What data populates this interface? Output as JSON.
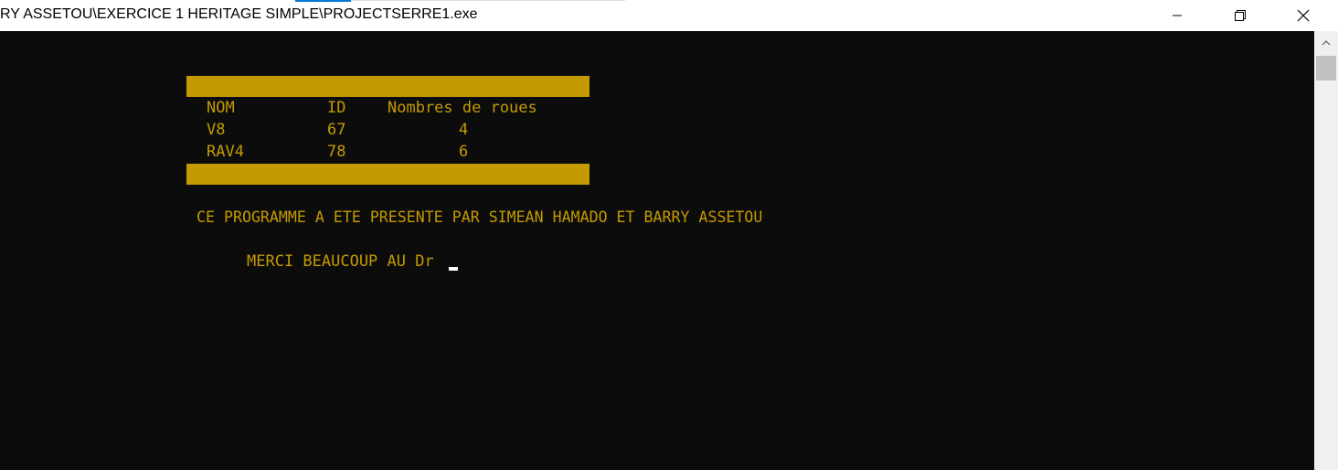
{
  "window": {
    "title": "RY ASSETOU\\EXERCICE 1 HERITAGE SIMPLE\\PROJECTSERRE1.exe",
    "controls": {
      "minimize_icon": "minimize-icon",
      "maximize_icon": "restore-icon",
      "close_icon": "close-icon"
    }
  },
  "console": {
    "table": {
      "headers": [
        "NOM",
        "ID",
        "Nombres de roues"
      ],
      "rows": [
        [
          "V8",
          "67",
          "4"
        ],
        [
          "RAV4",
          "78",
          "6"
        ]
      ]
    },
    "credit_line": "CE PROGRAMME A ETE PRESENTE PAR SIMEAN HAMADO ET BARRY ASSETOU",
    "thanks_line": "MERCI BEAUCOUP AU Dr"
  },
  "colors": {
    "console_background": "#0c0c0c",
    "console_text": "#c49a00",
    "highlight_bar": "#c49a00",
    "cursor": "#ffffff"
  }
}
